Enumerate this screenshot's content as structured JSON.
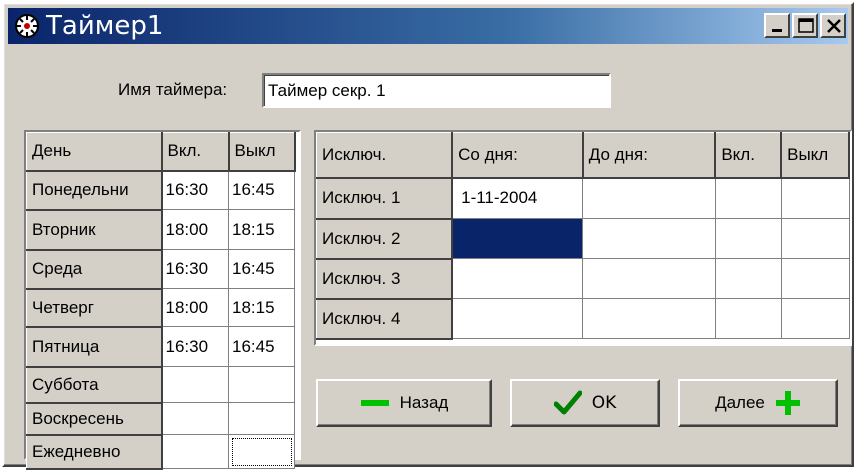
{
  "window": {
    "title": "Таймер1"
  },
  "timer_name": {
    "label": "Имя таймера:",
    "value": "Таймер секр. 1"
  },
  "days_table": {
    "headers": [
      "День",
      "Вкл.",
      "Выкл"
    ],
    "rows": [
      [
        "Понедельни",
        "16:30",
        "16:45"
      ],
      [
        "Вторник",
        "18:00",
        "18:15"
      ],
      [
        "Среда",
        "16:30",
        "16:45"
      ],
      [
        "Четверг",
        "18:00",
        "18:15"
      ],
      [
        "Пятница",
        "16:30",
        "16:45"
      ],
      [
        "Суббота",
        "",
        ""
      ],
      [
        "Воскресень",
        "",
        ""
      ],
      [
        "Ежедневно",
        "",
        ""
      ]
    ]
  },
  "exceptions_table": {
    "headers": [
      "Исключ.",
      "Со дня:",
      "До дня:",
      "Вкл.",
      "Выкл"
    ],
    "rows": [
      [
        "Исключ. 1",
        "1-11-2004",
        "",
        "",
        ""
      ],
      [
        "Исключ. 2",
        "",
        "",
        "",
        ""
      ],
      [
        "Исключ. 3",
        "",
        "",
        "",
        ""
      ],
      [
        "Исключ. 4",
        "",
        "",
        "",
        ""
      ]
    ]
  },
  "buttons": {
    "back": "Назад",
    "ok": "OK",
    "next": "Далее"
  },
  "colors": {
    "selection": "#0a246a",
    "plus_minus": "#00c000",
    "check": "#008000"
  }
}
